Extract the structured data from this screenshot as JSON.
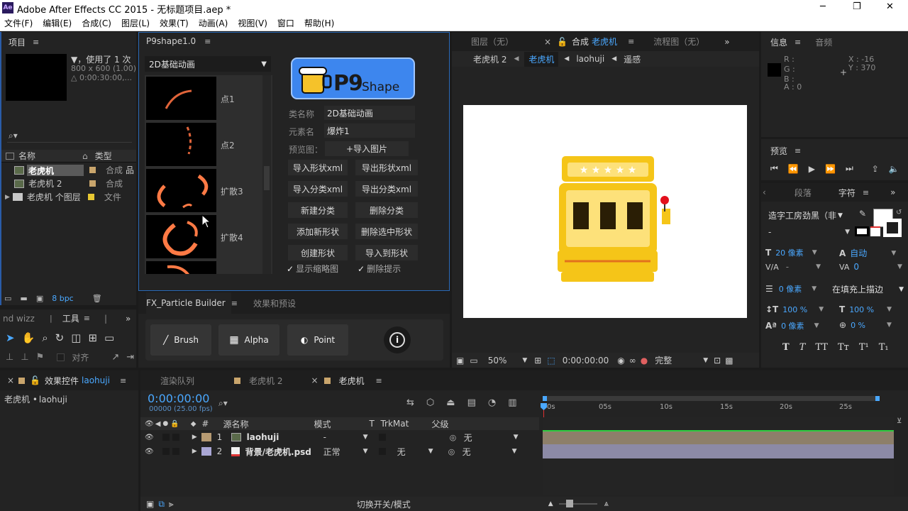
{
  "app": {
    "title": "Adobe After Effects CC 2015 - 无标题项目.aep *",
    "logo": "Ae"
  },
  "window_controls": {
    "minimize": "─",
    "maximize": "❐",
    "close": "✕"
  },
  "menu": [
    "文件(F)",
    "编辑(E)",
    "合成(C)",
    "图层(L)",
    "效果(T)",
    "动画(A)",
    "视图(V)",
    "窗口",
    "帮助(H)"
  ],
  "project": {
    "tab": "项目",
    "info_line1": "▼，使用了 1 次",
    "info_line2": "800 x 600 (1.00)",
    "info_line3": "△ 0:00:30:00,...",
    "search_icon": "⌕▾",
    "col_name": "名称",
    "col_type": "类型",
    "items": [
      {
        "name": "老虎机",
        "type": "合成",
        "color": "#c9a56c"
      },
      {
        "name": "老虎机 2",
        "type": "合成",
        "color": "#c9a56c"
      },
      {
        "name": "老虎机 个图层",
        "type": "文件",
        "color": "#e8c832"
      }
    ],
    "bpc": "8 bpc"
  },
  "p9": {
    "tab": "P9shape1.0",
    "category": "2D基础动画",
    "thumbs": [
      "点1",
      "点2",
      "扩散3",
      "扩散4"
    ],
    "logo_text": "P9",
    "logo_sub": "Shape",
    "class_label": "类名称",
    "class_value": "2D基础动画",
    "element_label": "元素名",
    "element_value": "爆炸1",
    "preview_label": "预览图：",
    "import_image": "+导入图片",
    "buttons": [
      "导入形状xml",
      "导出形状xml",
      "导入分类xml",
      "导出分类xml",
      "新建分类",
      "删除分类",
      "添加新形状",
      "删除选中形状",
      "创建形状",
      "导入到形状"
    ],
    "show_thumb": "显示缩略图",
    "delete_tip": "删除提示",
    "check": "✓"
  },
  "fx": {
    "tab1": "FX_Particle Builder",
    "tab2": "效果和预设",
    "brush": "Brush",
    "alpha": "Alpha",
    "point": "Point",
    "info": "i"
  },
  "tools": {
    "left_cut": "nd wizz",
    "tab": "工具",
    "align": "对齐"
  },
  "comp": {
    "tab_layer": "图层（无）",
    "tab_comp_prefix": "合成",
    "tab_comp_name": "老虎机",
    "tab_flow": "流程图（无）",
    "crumbs": [
      "老虎机 2",
      "老虎机",
      "laohuji",
      "遥感"
    ],
    "zoom": "50%",
    "timecode": "0:00:00:00",
    "quality": "完整"
  },
  "info": {
    "tab1": "信息",
    "tab2": "音频",
    "r": "R :",
    "g": "G :",
    "b": "B :",
    "a": "A : 0",
    "x": "X : -16",
    "y": "Y : 370"
  },
  "preview": {
    "tab": "预览"
  },
  "character": {
    "tab1": "段落",
    "tab2": "字符",
    "font": "造字工房劲黑（非",
    "style": "-",
    "size": "20 像素",
    "leading": "自动",
    "kerning": "-",
    "tracking": "0",
    "stroke": "0 像素",
    "stroke_mode": "在填充上描边",
    "vscale": "100 %",
    "hscale": "100 %",
    "baseline": "0 像素",
    "tsume": "0 %",
    "styles": [
      "T",
      "T",
      "TT",
      "Tт",
      "T¹",
      "T₁"
    ]
  },
  "effects": {
    "tab": "效果控件",
    "tab_layer": "laohuji",
    "path_prefix": "老虎机 • ",
    "path_layer": "laohuji"
  },
  "timeline": {
    "tab_render": "渲染队列",
    "tab_comp2": "老虎机 2",
    "tab_comp": "老虎机",
    "timecode": "0:00:00:00",
    "fps": "00000 (25.00 fps)",
    "search": "⌕▾",
    "col_hash": "#",
    "col_source": "源名称",
    "col_mode": "模式",
    "col_t": "T",
    "col_trkmat": "TrkMat",
    "col_parent": "父级",
    "ruler": [
      "0s",
      "05s",
      "10s",
      "15s",
      "20s",
      "25s"
    ],
    "layers": [
      {
        "num": "1",
        "name": "laohuji",
        "mode": "-",
        "trkmat": "",
        "parent": "无",
        "color": "#b69a72"
      },
      {
        "num": "2",
        "name": "背景/老虎机.psd",
        "mode": "正常",
        "trkmat": "无",
        "parent": "无",
        "color": "#a9a6d4"
      }
    ],
    "footer": "切换开关/模式"
  },
  "colors": {
    "accent": "#4aa8ff",
    "panel": "#232323",
    "slot_yellow": "#f5c518"
  }
}
